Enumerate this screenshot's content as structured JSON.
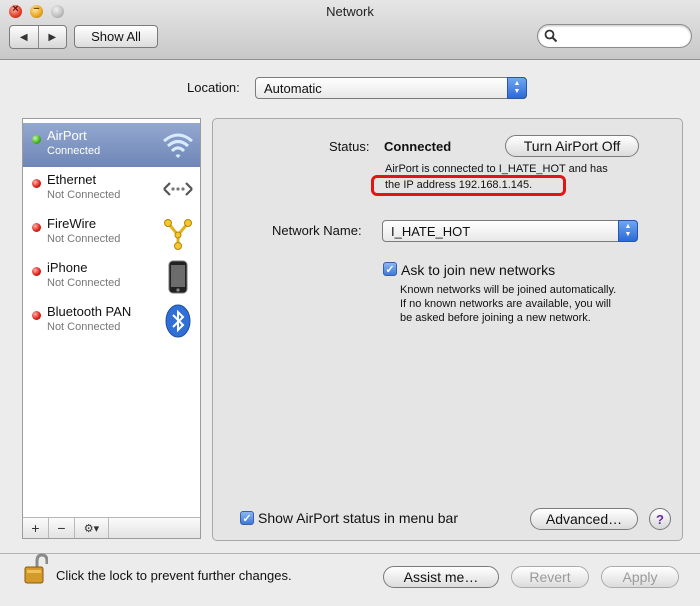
{
  "window": {
    "title": "Network"
  },
  "toolbar": {
    "back_glyph": "◀",
    "forward_glyph": "▶",
    "show_all_label": "Show All",
    "search_placeholder": ""
  },
  "location": {
    "label": "Location:",
    "value": "Automatic"
  },
  "sidebar": {
    "services": [
      {
        "name": "AirPort",
        "status": "Connected",
        "dot": "green",
        "icon": "wifi-icon",
        "selected": true
      },
      {
        "name": "Ethernet",
        "status": "Not Connected",
        "dot": "red",
        "icon": "ethernet-icon",
        "selected": false
      },
      {
        "name": "FireWire",
        "status": "Not Connected",
        "dot": "red",
        "icon": "firewire-icon",
        "selected": false
      },
      {
        "name": "iPhone",
        "status": "Not Connected",
        "dot": "red",
        "icon": "iphone-icon",
        "selected": false
      },
      {
        "name": "Bluetooth PAN",
        "status": "Not Connected",
        "dot": "red",
        "icon": "bluetooth-icon",
        "selected": false
      }
    ],
    "footer": {
      "add": "+",
      "remove": "−",
      "action": "⚙▾"
    }
  },
  "detail": {
    "status_label": "Status:",
    "status_value": "Connected",
    "turn_off_label": "Turn AirPort Off",
    "status_desc_line1": "AirPort is connected to I_HATE_HOT and has",
    "status_desc_line2": "the IP address 192.168.1.145.",
    "network_name_label": "Network Name:",
    "network_name_value": "I_HATE_HOT",
    "ask_join_label": "Ask to join new networks",
    "ask_join_checked": true,
    "ask_join_desc_line1": "Known networks will be joined automatically.",
    "ask_join_desc_line2": "If no known networks are available, you will",
    "ask_join_desc_line3": "be asked before joining a new network.",
    "show_status_label": "Show AirPort status in menu bar",
    "show_status_checked": true,
    "advanced_label": "Advanced…",
    "help_label": "?"
  },
  "footer": {
    "lock_text": "Click the lock to prevent further changes.",
    "assist_label": "Assist me…",
    "revert_label": "Revert",
    "apply_label": "Apply"
  },
  "colors": {
    "highlight": "#e01616",
    "selection": "#7d93c2",
    "accent": "#3d79d8"
  }
}
